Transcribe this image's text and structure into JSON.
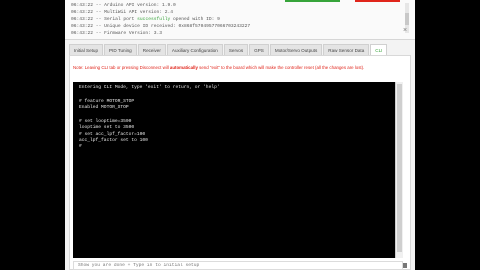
{
  "log": {
    "lines": [
      "06:43:22 -- Arduino API version: 1.9.0",
      "06:43:22 -- MultiWii API version: 2.4",
      "06:43:22 -- Serial port successfully opened with ID: 9",
      "06:43:22 -- Unique device ID received: 0x868f57049577066703243227",
      "06:43:22 -- Firmware Version: 3.3"
    ],
    "highlight_word": "successfully"
  },
  "tabs": [
    {
      "label": "Initial Setup",
      "active": false
    },
    {
      "label": "PID Tuning",
      "active": false
    },
    {
      "label": "Receiver",
      "active": false
    },
    {
      "label": "Auxiliary Configuration",
      "active": false
    },
    {
      "label": "Servos",
      "active": false
    },
    {
      "label": "GPS",
      "active": false
    },
    {
      "label": "Motor/Servo Outputs",
      "active": false
    },
    {
      "label": "Raw Sensor Data",
      "active": false
    },
    {
      "label": "CLI",
      "active": true
    }
  ],
  "cli": {
    "note_prefix": "Note: Leaving CLI tab or pressing Disconnect will ",
    "note_bold": "automatically",
    "note_suffix": " send \"exit\" to the board which will make the controller reset (all the changes are lost).",
    "terminal_lines": [
      "Entering CLI Mode, type 'exit' to return, or 'help'",
      "",
      "# feature MOTOR_STOP",
      "Enabled MOTOR_STOP",
      "",
      "# set looptime=3500",
      "looptime set to 3500",
      "# set acc_lpf_factor=100",
      "acc_lpf_factor set to 100",
      "#"
    ],
    "input_placeholder": "Show you are done + Type in to initial setup"
  },
  "colors": {
    "accent": "#37a43a",
    "warning": "#e0251b",
    "terminal_bg": "#000000",
    "terminal_fg": "#e8e8e8"
  },
  "icons": {
    "close": "close-icon",
    "pause": "pause-icon"
  }
}
